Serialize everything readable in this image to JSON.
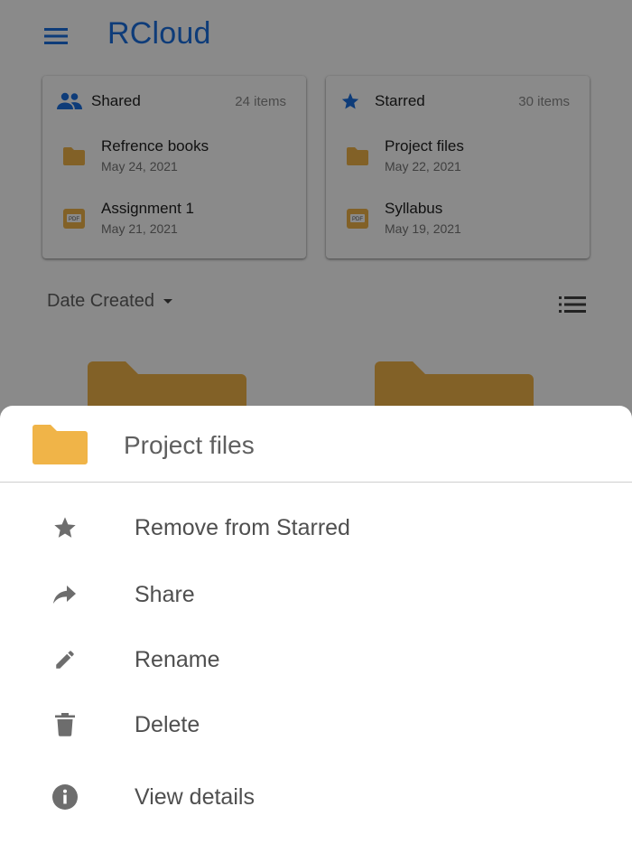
{
  "app": {
    "title": "RCloud"
  },
  "colors": {
    "accent": "#1a6fe0",
    "folder": "#f0b448",
    "scrim": "rgba(0,0,0,0.46)"
  },
  "cards": {
    "shared": {
      "title": "Shared",
      "count": "24 items",
      "icon": "people-icon",
      "files": [
        {
          "name": "Refrence books",
          "date": "May 24, 2021",
          "icon": "folder-icon"
        },
        {
          "name": "Assignment 1",
          "date": "May 21, 2021",
          "icon": "pdf-icon"
        }
      ]
    },
    "starred": {
      "title": "Starred",
      "count": "30 items",
      "icon": "star-icon",
      "files": [
        {
          "name": "Project files",
          "date": "May 22, 2021",
          "icon": "folder-icon"
        },
        {
          "name": "Syllabus",
          "date": "May 19, 2021",
          "icon": "pdf-icon"
        }
      ]
    }
  },
  "sort": {
    "label": "Date Created"
  },
  "pdf_badge": "PDF",
  "sheet": {
    "title": "Project files",
    "actions": [
      {
        "label": "Remove from Starred",
        "icon": "star-icon"
      },
      {
        "label": "Share",
        "icon": "share-icon"
      },
      {
        "label": "Rename",
        "icon": "pencil-icon"
      },
      {
        "label": "Delete",
        "icon": "trash-icon"
      },
      {
        "label": "View details",
        "icon": "info-icon"
      }
    ]
  }
}
